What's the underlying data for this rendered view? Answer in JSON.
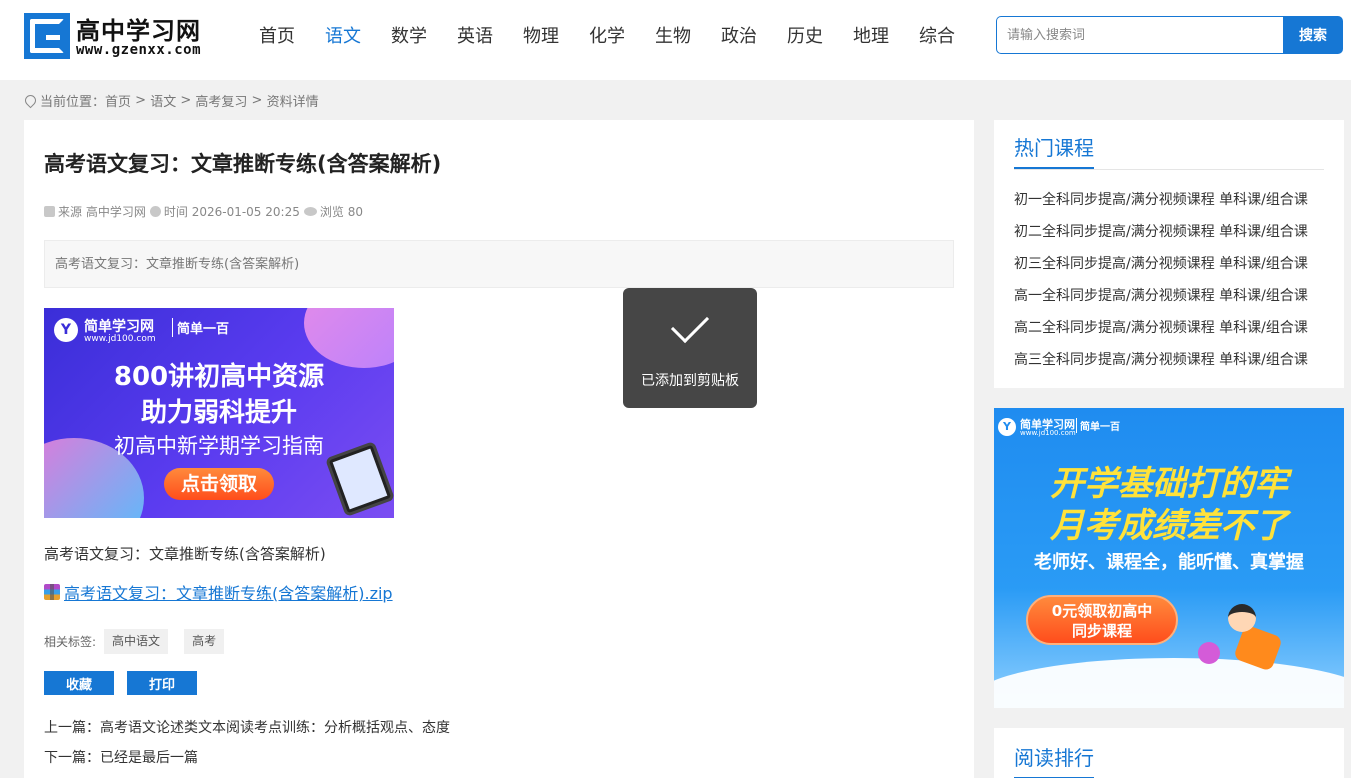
{
  "site": {
    "logo_letter": "G",
    "name": "高中学习网",
    "url": "www.gzenxx.com"
  },
  "nav": [
    {
      "label": "首页",
      "active": false
    },
    {
      "label": "语文",
      "active": true
    },
    {
      "label": "数学",
      "active": false
    },
    {
      "label": "英语",
      "active": false
    },
    {
      "label": "物理",
      "active": false
    },
    {
      "label": "化学",
      "active": false
    },
    {
      "label": "生物",
      "active": false
    },
    {
      "label": "政治",
      "active": false
    },
    {
      "label": "历史",
      "active": false
    },
    {
      "label": "地理",
      "active": false
    },
    {
      "label": "综合",
      "active": false
    }
  ],
  "search": {
    "placeholder": "请输入搜索词",
    "button": "搜索"
  },
  "breadcrumb": {
    "prefix": "当前位置：",
    "items": [
      "首页",
      "语文",
      "高考复习",
      "资料详情"
    ],
    "separator": " > "
  },
  "article": {
    "title": "高考语文复习：文章推断专练(含答案解析)",
    "meta": {
      "source_label": "来源",
      "source": "高中学习网",
      "time_label": "时间",
      "time": "2026-01-05 20:25",
      "views_label": "浏览",
      "views": "80"
    },
    "summary": "高考语文复习：文章推断专练(含答案解析)",
    "banner": {
      "logo_letter": "Y",
      "brand": "简单学习网",
      "brand_url": "www.jd100.com",
      "brand2": "简单一百",
      "line1": "800讲初高中资源",
      "line2": "助力弱科提升",
      "line3": "初高中新学期学习指南",
      "cta": "点击领取"
    },
    "body": "高考语文复习：文章推断专练(含答案解析)",
    "attachment": "高考语文复习：文章推断专练(含答案解析).zip",
    "tags_label": "相关标签:",
    "tags": [
      "高中语文",
      "高考"
    ],
    "buttons": {
      "favorite": "收藏",
      "print": "打印"
    },
    "prev_label": "上一篇：",
    "prev": "高考语文论述类文本阅读考点训练：分析概括观点、态度",
    "next_label": "下一篇：",
    "next": "已经是最后一篇"
  },
  "sidebar": {
    "hot_title": "热门课程",
    "courses": [
      "初一全科同步提高/满分视频课程 单科课/组合课",
      "初二全科同步提高/满分视频课程 单科课/组合课",
      "初三全科同步提高/满分视频课程 单科课/组合课",
      "高一全科同步提高/满分视频课程 单科课/组合课",
      "高二全科同步提高/满分视频课程 单科课/组合课",
      "高三全科同步提高/满分视频课程 单科课/组合课"
    ],
    "ad": {
      "logo_letter": "Y",
      "brand": "简单学习网",
      "brand_url": "www.jd100.com",
      "brand2": "简单一百",
      "line1": "开学基础打的牢",
      "line2": "月考成绩差不了",
      "line3": "老师好、课程全，能听懂、真掌握",
      "cta_line1": "0元领取初高中",
      "cta_line2": "同步课程"
    },
    "rank_title": "阅读排行"
  },
  "toast": {
    "message": "已添加到剪贴板"
  },
  "colors": {
    "accent": "#1677d4",
    "toast_bg": "#3c3c3c"
  }
}
